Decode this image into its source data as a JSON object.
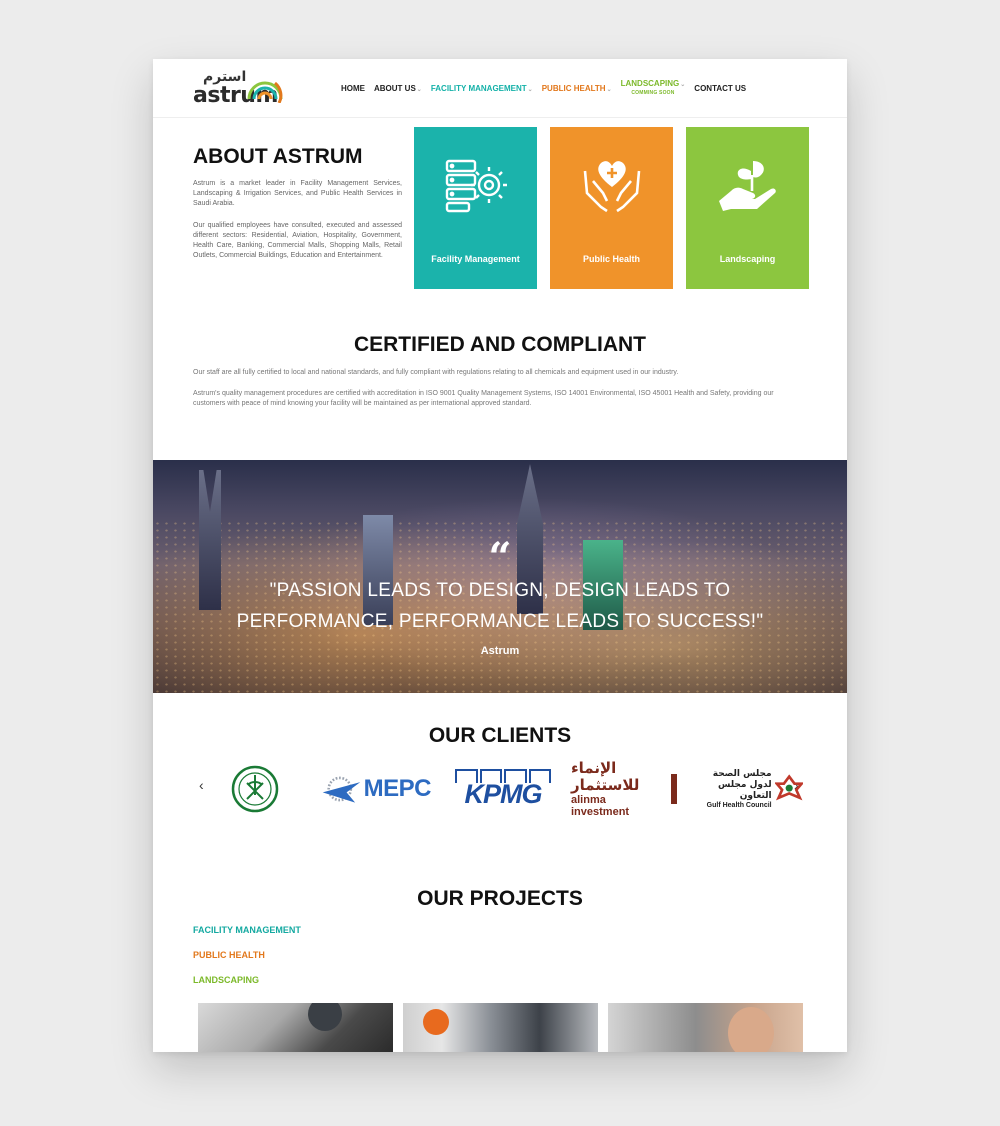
{
  "header": {
    "logo_ar": "استرم",
    "logo_en": "astrum",
    "nav": {
      "home": "HOME",
      "about": "ABOUT US",
      "facility": "FACILITY MANAGEMENT",
      "public_health": "PUBLIC HEALTH",
      "landscaping": "LANDSCAPING",
      "landscaping_sub": "COMMING SOON",
      "contact": "CONTACT US"
    }
  },
  "about": {
    "title": "ABOUT ASTRUM",
    "p1": "Astrum is a market leader in Facility Management Services, Landscaping & Irrigation Services, and Public Health Services in Saudi Arabia.",
    "p2": "Our qualified employees have consulted, executed and assessed different sectors: Residential, Aviation, Hospitality, Government, Health Care, Banking, Commercial Malls, Shopping Malls, Retail Outlets, Commercial Buildings, Education and Entertainment."
  },
  "services": [
    {
      "label": "Facility Management",
      "icon": "server-gear-icon",
      "color": "#1bb3ab"
    },
    {
      "label": "Public Health",
      "icon": "hands-heart-icon",
      "color": "#f0932a"
    },
    {
      "label": "Landscaping",
      "icon": "hand-plant-icon",
      "color": "#8cc63f"
    }
  ],
  "certified": {
    "title": "CERTIFIED AND COMPLIANT",
    "p1": "Our staff are all fully certified to local and national standards, and fully compliant with regulations relating to all chemicals and equipment used in our industry.",
    "p2": "Astrum's quality management procedures are certified with accreditation in ISO 9001 Quality Management Systems, ISO 14001 Environmental, ISO 45001 Health and Safety, providing our customers with peace of mind knowing your facility will be maintained as per international approved standard."
  },
  "quote": {
    "mark": "“",
    "text": "\"PASSION LEADS TO DESIGN, DESIGN LEADS TO PERFORMANCE, PERFORMANCE LEADS TO SUCCESS!\"",
    "author": "Astrum"
  },
  "clients": {
    "title": "OUR CLIENTS",
    "prev": "‹",
    "next": "›",
    "mepc": "MEPC",
    "kpmg": "KPMG",
    "alinma_ar": "الإنماء للاستثمار",
    "alinma_en": "alinma investment",
    "ghc_ar_1": "مجلس الصحة",
    "ghc_ar_2": "لدول مجلس التعاون",
    "ghc_en": "Gulf Health Council"
  },
  "projects": {
    "title": "OUR PROJECTS",
    "categories": [
      {
        "label": "FACILITY MANAGEMENT",
        "color": "#14a9a1"
      },
      {
        "label": "PUBLIC HEALTH",
        "color": "#e2781c"
      },
      {
        "label": "LANDSCAPING",
        "color": "#7cb92a"
      }
    ]
  }
}
